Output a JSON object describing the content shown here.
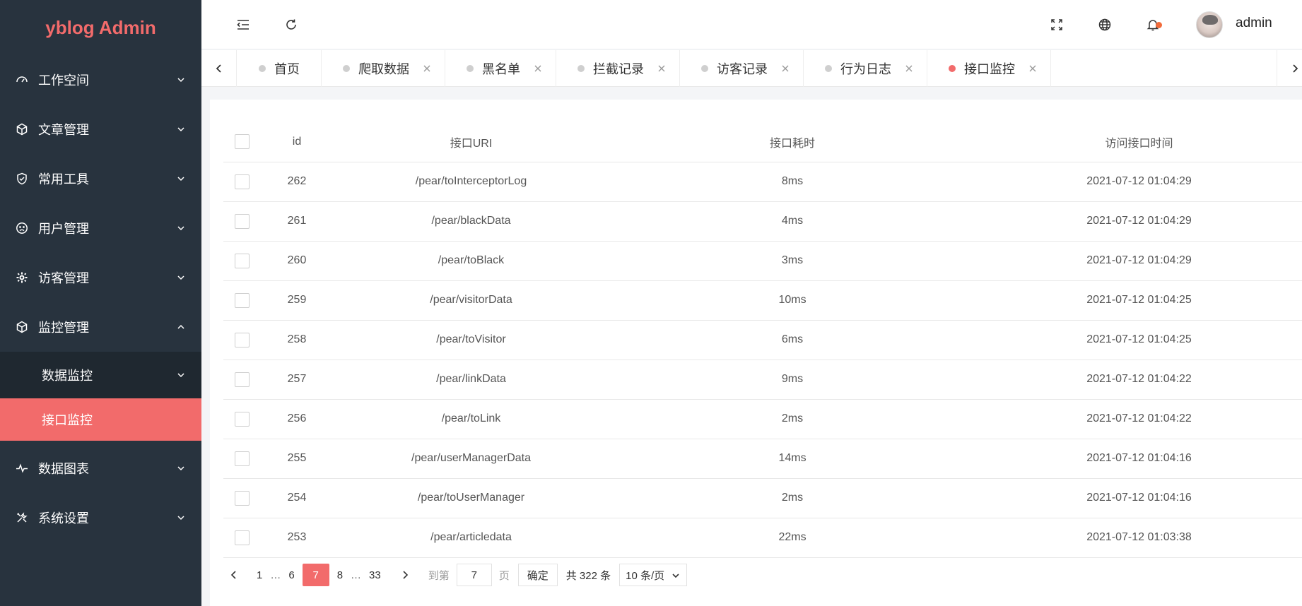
{
  "app": {
    "logo": "yblog Admin"
  },
  "sidebar": {
    "items": [
      {
        "label": "工作空间",
        "icon": "dashboard-icon"
      },
      {
        "label": "文章管理",
        "icon": "cube-icon"
      },
      {
        "label": "常用工具",
        "icon": "shield-icon"
      },
      {
        "label": "用户管理",
        "icon": "face-icon"
      },
      {
        "label": "访客管理",
        "icon": "gear-icon"
      },
      {
        "label": "监控管理",
        "icon": "cube-icon",
        "expanded": true
      }
    ],
    "sub_items": [
      {
        "label": "数据监控"
      },
      {
        "label": "接口监控",
        "active": true
      }
    ],
    "items_after": [
      {
        "label": "数据图表",
        "icon": "pulse-icon"
      },
      {
        "label": "系统设置",
        "icon": "tools-icon"
      }
    ],
    "accent_color": "#f26b6b"
  },
  "header": {
    "username": "admin"
  },
  "tabs": [
    {
      "label": "首页",
      "closable": false
    },
    {
      "label": "爬取数据",
      "closable": true
    },
    {
      "label": "黑名单",
      "closable": true
    },
    {
      "label": "拦截记录",
      "closable": true
    },
    {
      "label": "访客记录",
      "closable": true
    },
    {
      "label": "行为日志",
      "closable": true
    },
    {
      "label": "接口监控",
      "closable": true,
      "active": true
    }
  ],
  "table": {
    "columns": [
      "id",
      "接口URI",
      "接口耗时",
      "访问接口时间"
    ],
    "rows": [
      {
        "id": "262",
        "uri": "/pear/toInterceptorLog",
        "cost": "8ms",
        "time": "2021-07-12 01:04:29"
      },
      {
        "id": "261",
        "uri": "/pear/blackData",
        "cost": "4ms",
        "time": "2021-07-12 01:04:29"
      },
      {
        "id": "260",
        "uri": "/pear/toBlack",
        "cost": "3ms",
        "time": "2021-07-12 01:04:29"
      },
      {
        "id": "259",
        "uri": "/pear/visitorData",
        "cost": "10ms",
        "time": "2021-07-12 01:04:25"
      },
      {
        "id": "258",
        "uri": "/pear/toVisitor",
        "cost": "6ms",
        "time": "2021-07-12 01:04:25"
      },
      {
        "id": "257",
        "uri": "/pear/linkData",
        "cost": "9ms",
        "time": "2021-07-12 01:04:22"
      },
      {
        "id": "256",
        "uri": "/pear/toLink",
        "cost": "2ms",
        "time": "2021-07-12 01:04:22"
      },
      {
        "id": "255",
        "uri": "/pear/userManagerData",
        "cost": "14ms",
        "time": "2021-07-12 01:04:16"
      },
      {
        "id": "254",
        "uri": "/pear/toUserManager",
        "cost": "2ms",
        "time": "2021-07-12 01:04:16"
      },
      {
        "id": "253",
        "uri": "/pear/articledata",
        "cost": "22ms",
        "time": "2021-07-12 01:03:38"
      }
    ]
  },
  "pagination": {
    "pages": [
      "1",
      "6",
      "7",
      "8",
      "33"
    ],
    "ellipsis": "…",
    "current": "7",
    "goto_label": "到第",
    "goto_value": "7",
    "page_unit": "页",
    "confirm_label": "确定",
    "total_text": "共 322 条",
    "page_size": "10 条/页"
  }
}
